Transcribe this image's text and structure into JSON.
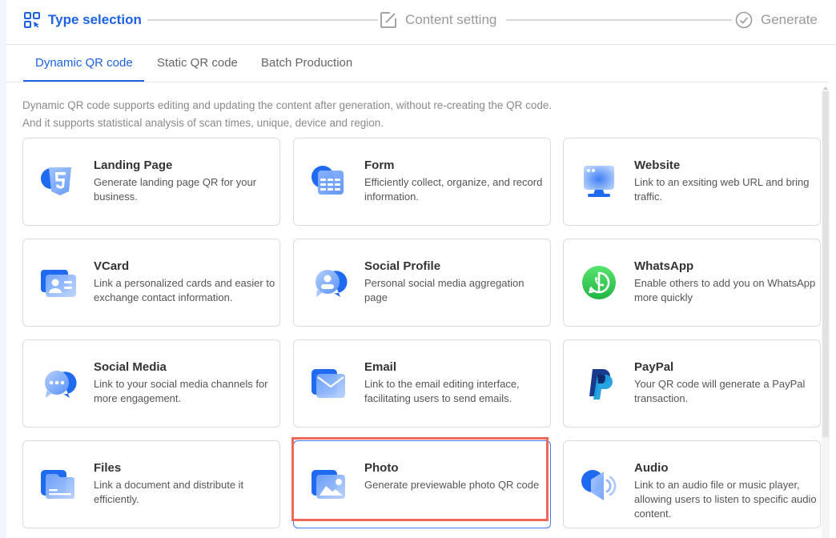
{
  "steps": [
    {
      "label": "Type selection",
      "icon": "qr-scan-icon",
      "state": "active"
    },
    {
      "label": "Content setting",
      "icon": "edit-icon",
      "state": "pending"
    },
    {
      "label": "Generate",
      "icon": "check-circle-icon",
      "state": "pending"
    }
  ],
  "tabs": [
    {
      "label": "Dynamic QR code",
      "active": true
    },
    {
      "label": "Static QR code",
      "active": false
    },
    {
      "label": "Batch Production",
      "active": false
    }
  ],
  "description": {
    "line1": "Dynamic QR code supports editing and updating the content after generation, without re-creating the QR code.",
    "line2": "And it supports statistical analysis of scan times, unique, device and region."
  },
  "cards": [
    {
      "title": "Landing Page",
      "text": "Generate landing page QR for your business.",
      "icon": "html5-icon"
    },
    {
      "title": "Form",
      "text": "Efficiently collect, organize, and record information.",
      "icon": "form-table-icon"
    },
    {
      "title": "Website",
      "text": "Link to an exsiting web URL and bring traffic.",
      "icon": "monitor-icon"
    },
    {
      "title": "VCard",
      "text": "Link a personalized cards and easier to exchange contact information.",
      "icon": "contact-card-icon"
    },
    {
      "title": "Social Profile",
      "text": "Personal social media aggregation page",
      "icon": "profile-chat-icon"
    },
    {
      "title": "WhatsApp",
      "text": "Enable others to add you on WhatsApp more quickly",
      "icon": "whatsapp-icon"
    },
    {
      "title": "Social Media",
      "text": "Link to your social media channels for more engagement.",
      "icon": "chat-bubbles-icon"
    },
    {
      "title": "Email",
      "text": "Link to the email editing interface, facilitating users to send emails.",
      "icon": "envelope-icon"
    },
    {
      "title": "PayPal",
      "text": "Your QR code will generate a PayPal transaction.",
      "icon": "paypal-icon"
    },
    {
      "title": "Files",
      "text": "Link a document and distribute it efficiently.",
      "icon": "folder-icon"
    },
    {
      "title": "Photo",
      "text": "Generate previewable photo QR code",
      "icon": "photo-icon",
      "selected": true
    },
    {
      "title": "Audio",
      "text": "Link to an audio file or music player, allowing users to listen to specific audio content.",
      "icon": "speaker-icon"
    }
  ],
  "colors": {
    "accent": "#1d62e5",
    "highlight": "#f0685a",
    "whatsapp": "#2fc24f",
    "paypal_dark": "#1a3a8c",
    "paypal_light": "#1d9fe0"
  }
}
